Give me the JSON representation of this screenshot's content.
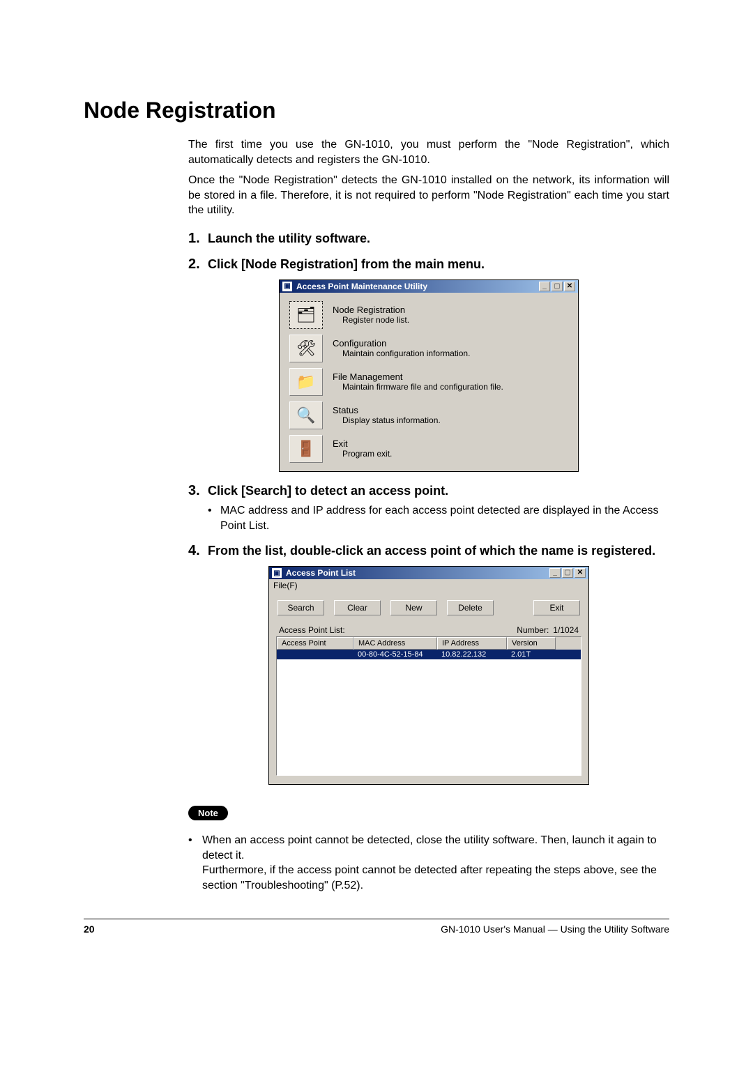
{
  "heading": "Node Registration",
  "intro": [
    "The first time you use the GN-1010, you must perform the \"Node Registration\", which automatically detects and registers the GN-1010.",
    "Once the \"Node Registration\" detects the GN-1010 installed on the network, its information will be stored in a file.  Therefore, it is not required to perform \"Node Registration\" each time you start the utility."
  ],
  "steps": {
    "s1": {
      "num": "1.",
      "title": "Launch the utility software."
    },
    "s2": {
      "num": "2.",
      "title": "Click [Node Registration] from the main menu."
    },
    "s3": {
      "num": "3.",
      "title": "Click [Search] to detect an access point.",
      "bullet": "MAC address and IP address for each access point detected are displayed in the Access Point List."
    },
    "s4": {
      "num": "4.",
      "title": "From the list, double-click an access point of which the name is registered."
    }
  },
  "win1": {
    "title": "Access Point Maintenance Utility",
    "items": [
      {
        "title": "Node Registration",
        "sub": "Register node list.",
        "glyph": "🗂"
      },
      {
        "title": "Configuration",
        "sub": "Maintain configuration information.",
        "glyph": "🛠"
      },
      {
        "title": "File Management",
        "sub": "Maintain firmware file and configuration file.",
        "glyph": "📁"
      },
      {
        "title": "Status",
        "sub": "Display status information.",
        "glyph": "🔍"
      },
      {
        "title": "Exit",
        "sub": "Program exit.",
        "glyph": "🚪"
      }
    ]
  },
  "win2": {
    "title": "Access Point List",
    "menu_file": "File(F)",
    "buttons": {
      "search": "Search",
      "clear": "Clear",
      "new": "New",
      "delete": "Delete",
      "exit": "Exit"
    },
    "list_label": "Access Point List:",
    "number_label": "Number:",
    "number_value": "1/1024",
    "cols": {
      "ap": "Access Point",
      "mac": "MAC Address",
      "ip": "IP Address",
      "ver": "Version"
    },
    "row": {
      "ap": "",
      "mac": "00-80-4C-52-15-84",
      "ip": "10.82.22.132",
      "ver": "2.01T"
    }
  },
  "note_label": "Note",
  "note_text": "When an access point cannot be detected, close the utility software. Then, launch it again to detect it.",
  "note_text2": "Furthermore, if the access point cannot be detected after repeating the steps above, see the section  \"Troubleshooting\" (P.52).",
  "footer": {
    "page": "20",
    "text": "GN-1010 User's Manual — Using the Utility Software"
  }
}
